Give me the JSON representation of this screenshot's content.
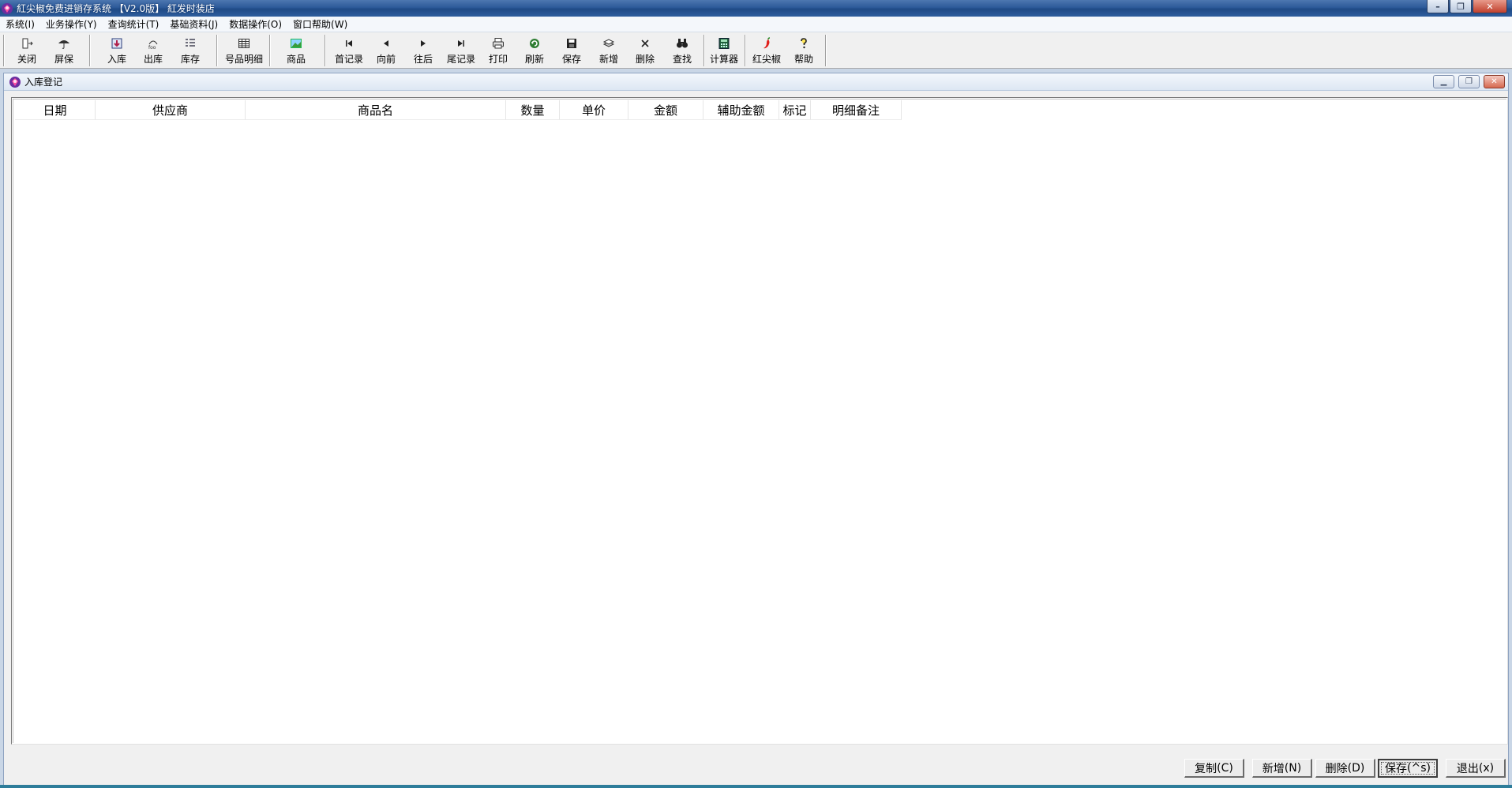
{
  "window": {
    "title": "紅尖椒免费进销存系统 【V2.0版】 紅发时装店",
    "controls": {
      "minimize": "–",
      "restore": "❐",
      "close": "✕"
    }
  },
  "menu": [
    "系统(I)",
    "业务操作(Y)",
    "查询统计(T)",
    "基础资料(J)",
    "数据操作(O)",
    "窗口帮助(W)"
  ],
  "toolbar": [
    {
      "label": "关闭",
      "icon": "exit-door-icon"
    },
    {
      "label": "屏保",
      "icon": "umbrella-icon"
    },
    {
      "label": "入库",
      "icon": "stock-in-icon"
    },
    {
      "label": "出库",
      "icon": "stock-out-icon"
    },
    {
      "label": "库存",
      "icon": "inventory-list-icon"
    },
    {
      "label": "号品明细",
      "icon": "table-grid-icon"
    },
    {
      "label": "商品",
      "icon": "product-image-icon"
    },
    {
      "label": "首记录",
      "icon": "first-record-icon"
    },
    {
      "label": "向前",
      "icon": "previous-icon"
    },
    {
      "label": "往后",
      "icon": "next-icon"
    },
    {
      "label": "尾记录",
      "icon": "last-record-icon"
    },
    {
      "label": "打印",
      "icon": "printer-icon"
    },
    {
      "label": "刷新",
      "icon": "refresh-icon"
    },
    {
      "label": "保存",
      "icon": "floppy-save-icon"
    },
    {
      "label": "新增",
      "icon": "add-stack-icon"
    },
    {
      "label": "删除",
      "icon": "delete-x-icon"
    },
    {
      "label": "查找",
      "icon": "binoculars-icon"
    },
    {
      "label": "计算器",
      "icon": "calculator-icon"
    },
    {
      "label": "红尖椒",
      "icon": "chili-pepper-icon"
    },
    {
      "label": "帮助",
      "icon": "help-question-icon"
    }
  ],
  "child_window": {
    "title": "入库登记",
    "controls": {
      "minimize": "▁",
      "restore": "❐",
      "close": "✕"
    }
  },
  "table": {
    "columns": [
      "日期",
      "供应商",
      "商品名",
      "数量",
      "单价",
      "金额",
      "辅助金额",
      "标记",
      "明细备注"
    ],
    "rows": []
  },
  "buttons": {
    "copy": {
      "label": "复制",
      "hotkey": "(C)"
    },
    "add": {
      "label": "新增",
      "hotkey": "(N)"
    },
    "delete": {
      "label": "删除",
      "hotkey": "(D)"
    },
    "save": {
      "label": "保存",
      "hotkey": "(^s)"
    },
    "exit": {
      "label": "退出",
      "hotkey": "(x)"
    }
  },
  "colors": {
    "title_bar": "#2d5a99",
    "desktop": "#c9d6e6",
    "accent_strip": "#2e7d9a"
  }
}
